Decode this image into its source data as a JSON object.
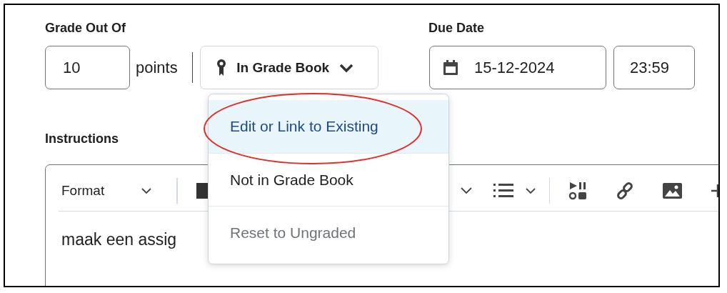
{
  "grade": {
    "label": "Grade Out Of",
    "value": "10",
    "unit": "points",
    "gradebook_button": "In Grade Book"
  },
  "due": {
    "label": "Due Date",
    "date": "15-12-2024",
    "time": "23:59"
  },
  "menu": {
    "items": [
      {
        "label": "Edit or Link to Existing",
        "selected": true,
        "disabled": false
      },
      {
        "label": "Not in Grade Book",
        "selected": false,
        "disabled": false
      },
      {
        "label": "Reset to Ungraded",
        "selected": false,
        "disabled": true
      }
    ]
  },
  "instructions": {
    "label": "Instructions",
    "format": "Format",
    "body": "maak een assig"
  },
  "annotation": {
    "kind": "ellipse"
  }
}
